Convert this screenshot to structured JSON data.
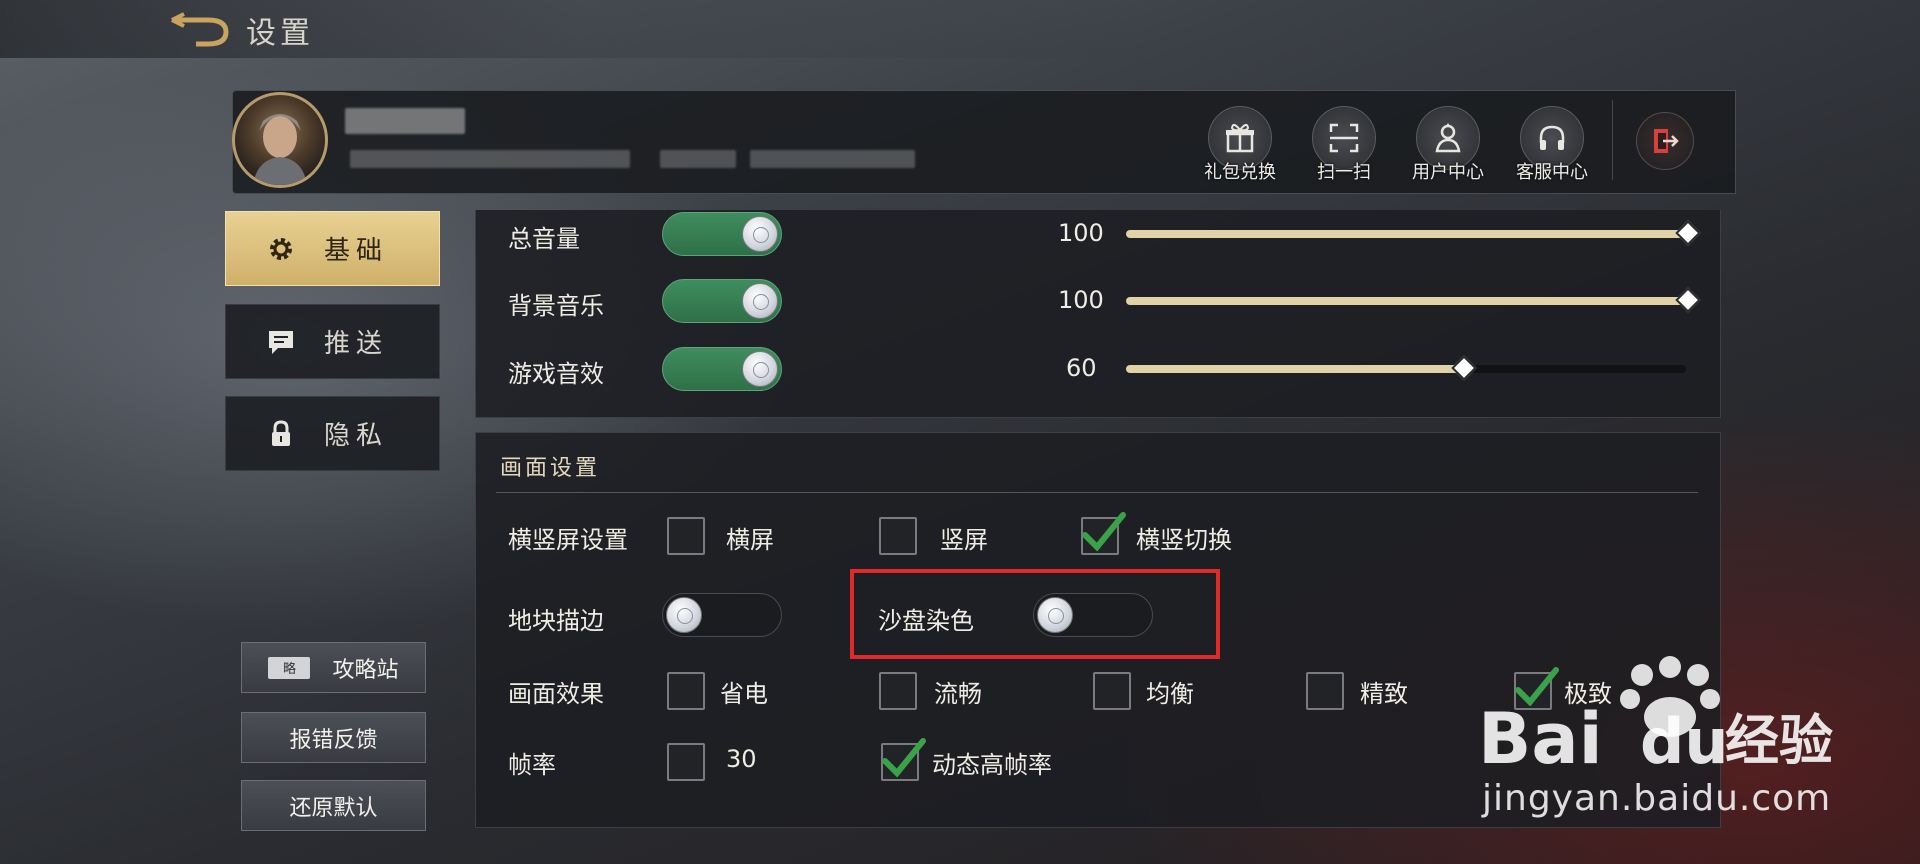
{
  "window": {
    "title": "设置"
  },
  "profile": {
    "actions": [
      {
        "label": "礼包兑换",
        "icon": "gift-icon"
      },
      {
        "label": "扫一扫",
        "icon": "scan-icon"
      },
      {
        "label": "用户中心",
        "icon": "user-center-icon"
      },
      {
        "label": "客服中心",
        "icon": "headset-icon"
      }
    ],
    "logout_icon": "logout-icon"
  },
  "sidebar": {
    "tabs": [
      {
        "label": "基础",
        "icon": "gear-icon",
        "active": true
      },
      {
        "label": "推送",
        "icon": "message-icon",
        "active": false
      },
      {
        "label": "隐私",
        "icon": "lock-icon",
        "active": false
      }
    ],
    "guide": {
      "label": "攻略站",
      "tag": "略"
    },
    "feedback_label": "报错反馈",
    "reset_label": "还原默认"
  },
  "audio": {
    "master": {
      "label": "总音量",
      "enabled": true,
      "value": 100
    },
    "music": {
      "label": "背景音乐",
      "enabled": true,
      "value": 100
    },
    "sfx": {
      "label": "游戏音效",
      "enabled": true,
      "value": 60
    }
  },
  "display": {
    "section_title": "画面设置",
    "orientation": {
      "label": "横竖屏设置",
      "options": [
        {
          "label": "横屏",
          "checked": false
        },
        {
          "label": "竖屏",
          "checked": false
        },
        {
          "label": "横竖切换",
          "checked": true
        }
      ]
    },
    "tile_outline": {
      "label": "地块描边",
      "enabled": false
    },
    "sandbox_tint": {
      "label": "沙盘染色",
      "enabled": false
    },
    "quality": {
      "label": "画面效果",
      "options": [
        {
          "label": "省电",
          "checked": false
        },
        {
          "label": "流畅",
          "checked": false
        },
        {
          "label": "均衡",
          "checked": false
        },
        {
          "label": "精致",
          "checked": false
        },
        {
          "label": "极致",
          "checked": true
        }
      ]
    },
    "framerate": {
      "label": "帧率",
      "options": [
        {
          "label": "30",
          "checked": false
        },
        {
          "label": "动态高帧率",
          "checked": true
        }
      ]
    }
  },
  "watermark": {
    "brand": "Bai",
    "brand2": "du",
    "suffix": "经验",
    "url": "jingyan.baidu.com"
  },
  "colors": {
    "accent_gold": "#cfb06a",
    "toggle_on": "#3f8d5e",
    "highlight_red": "#e02a2a",
    "check_green": "#3aa34a"
  }
}
